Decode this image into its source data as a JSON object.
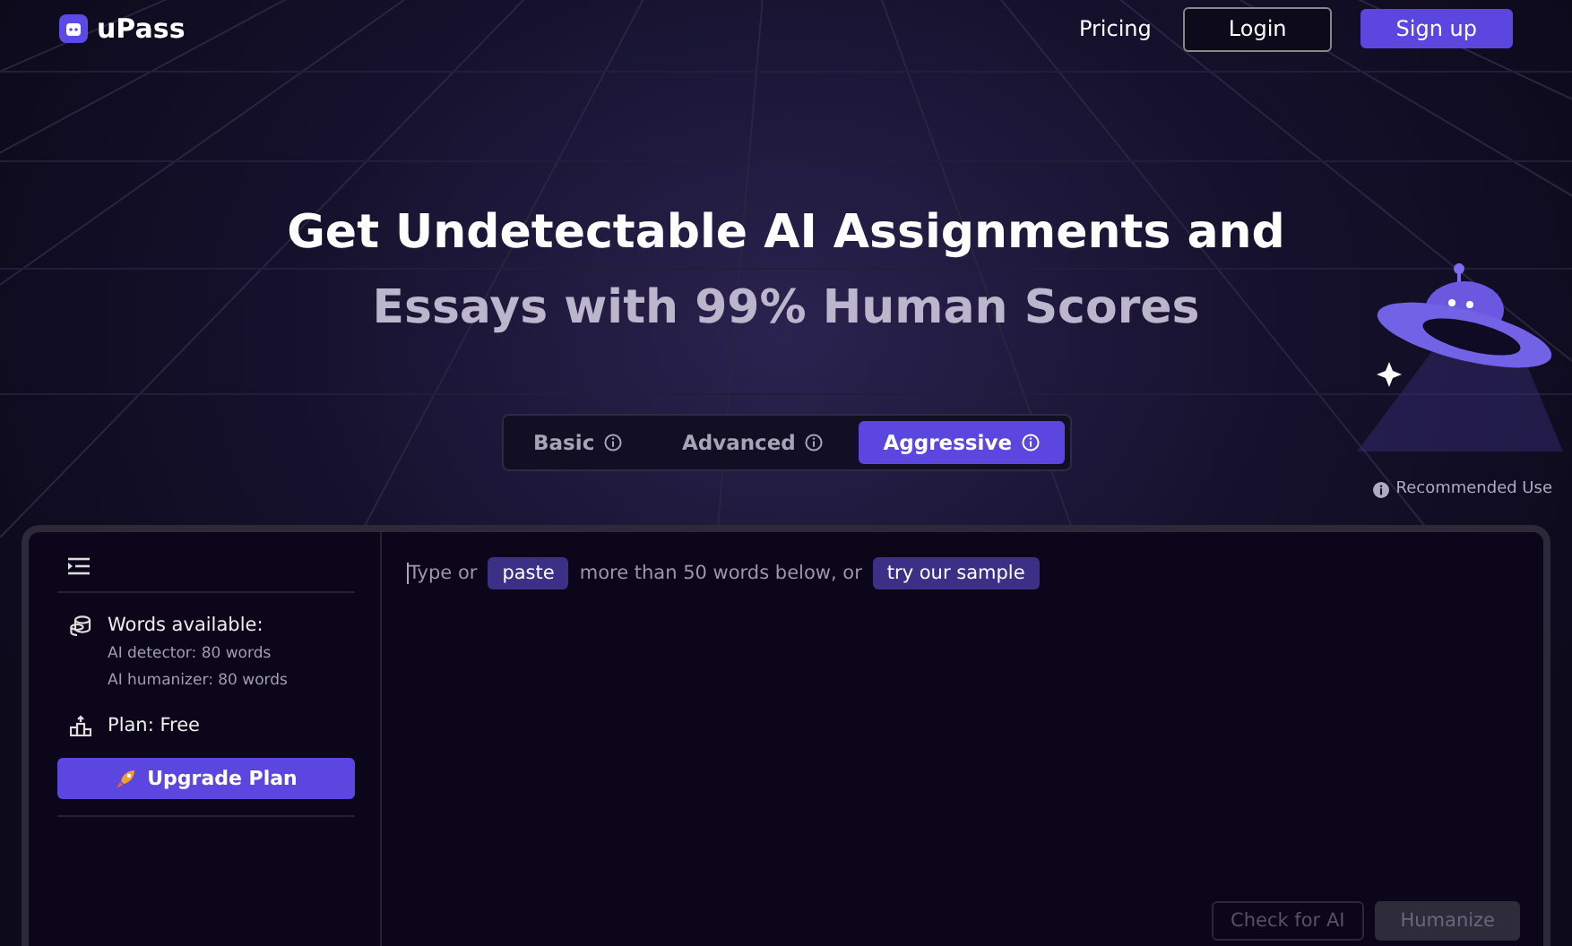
{
  "header": {
    "brand": "uPass",
    "nav": [
      {
        "label": "Pricing",
        "kind": "link"
      },
      {
        "label": "Login",
        "kind": "outline"
      },
      {
        "label": "Sign up",
        "kind": "primary"
      }
    ]
  },
  "hero": {
    "title_line_1": "Get Undetectable AI Assignments and",
    "title_line_2": "Essays with 99% Human Scores"
  },
  "modes": [
    {
      "label": "Basic",
      "selected": false
    },
    {
      "label": "Advanced",
      "selected": false
    },
    {
      "label": "Aggressive",
      "selected": true
    }
  ],
  "recommended": "Recommended Use",
  "sidebar": {
    "words_title": "Words available:",
    "detector": "AI detector: 80 words",
    "humanizer": "AI humanizer: 80 words",
    "plan": "Plan: Free",
    "upgrade": "Upgrade Plan"
  },
  "editor": {
    "prompt": [
      {
        "kind": "text",
        "text": "Type or"
      },
      {
        "kind": "button",
        "text": "paste"
      },
      {
        "kind": "text",
        "text": "more than 50 words below, or"
      },
      {
        "kind": "button",
        "text": "try our sample"
      }
    ],
    "actions": [
      {
        "label": "Check for AI",
        "kind": "outline",
        "disabled": true
      },
      {
        "label": "Humanize",
        "kind": "filled",
        "disabled": true
      }
    ]
  }
}
